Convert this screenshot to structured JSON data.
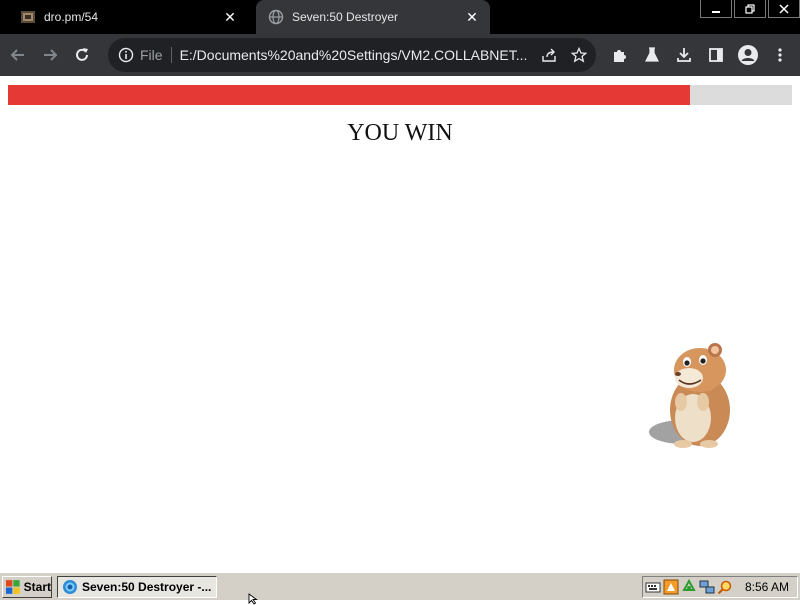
{
  "browser": {
    "tabs": [
      {
        "title": "dro.pm/54",
        "active": false
      },
      {
        "title": "Seven:50 Destroyer",
        "active": true
      }
    ],
    "address_bar": {
      "scheme_label": "File",
      "url": "E:/Documents%20and%20Settings/VM2.COLLABNET..."
    }
  },
  "page": {
    "progress": {
      "value": 0.87,
      "fill_color": "#e53935",
      "track_color": "#dcdcdc"
    },
    "message": "YOU WIN"
  },
  "taskbar": {
    "start_label": "Start",
    "task_label": "Seven:50 Destroyer -...",
    "clock": "8:56 AM"
  },
  "icons": [
    "tab-favicon",
    "globe-icon",
    "close-icon",
    "minimize-icon",
    "restore-icon",
    "back-arrow-icon",
    "forward-arrow-icon",
    "reload-icon",
    "info-icon",
    "share-icon",
    "star-icon",
    "puzzle-icon",
    "flask-icon",
    "download-icon",
    "sidebar-icon",
    "profile-icon",
    "kebab-menu-icon",
    "windows-flag-icon",
    "hamster-sprite"
  ]
}
